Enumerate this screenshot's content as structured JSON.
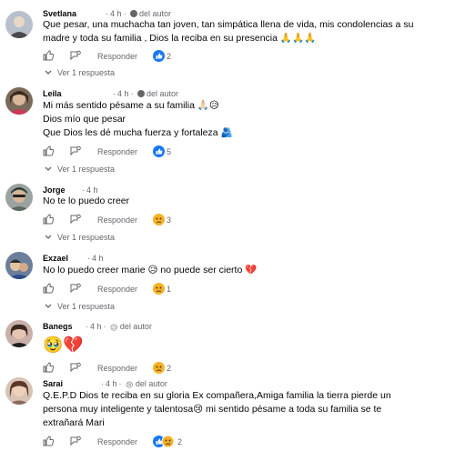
{
  "comments": [
    {
      "author": "Svetlana",
      "time": "4 h",
      "badge": "del autor",
      "lines": [
        "Que pesar, una muchacha tan joven, tan simpática llena de vida, mis condolencias a su",
        "madre y toda su familia , Dios la reciba en su presencia 🙏🙏🙏"
      ],
      "reply_label": "Responder",
      "reaction_count": "2",
      "replies_label": "Ver 1 respuesta"
    },
    {
      "author": "Leila",
      "time": "4 h",
      "badge": "del autor",
      "lines": [
        "Mi más sentido pésame a su familia 🙏🏻😥",
        "Dios mío que pesar",
        "Que Dios les dé mucha fuerza y fortaleza 🫂"
      ],
      "reply_label": "Responder",
      "reaction_count": "5",
      "replies_label": "Ver 1 respuesta"
    },
    {
      "author": "Jorge",
      "time": "4 h",
      "lines": [
        "No te lo puedo creer"
      ],
      "reply_label": "Responder",
      "reaction_count": "3",
      "replies_label": "Ver 1 respuesta"
    },
    {
      "author": "Exzael",
      "time": "4 h",
      "lines": [
        "No lo puedo creer marie 😥 no puede ser cierto 💔"
      ],
      "reply_label": "Responder",
      "reaction_count": "1",
      "replies_label": "Ver 1 respuesta"
    },
    {
      "author": "Banegs",
      "time": "4 h",
      "badge": "del autor",
      "lines": [
        "🥹💔"
      ],
      "reply_label": "Responder",
      "reaction_count": "2"
    },
    {
      "author": "Sarai",
      "time": "4 h",
      "badge": "del autor",
      "lines": [
        "Q.E.P.D Dios te reciba en su gloria Ex compañera,Amiga familia la tierra pierde un",
        "persona muy inteligente y talentosa😢 mi sentido pésame a toda su familia se te",
        "extrañará Mari"
      ],
      "reply_label": "Responder",
      "reaction_count": "2"
    }
  ],
  "colors": {
    "text": "#050505",
    "meta": "#65676b",
    "like_blue": "#1877f2",
    "care_yellow": "#f7b125"
  },
  "icons": [
    "thumbs-up-outline-icon",
    "share-action-icon",
    "like-reaction-icon",
    "care-reaction-icon",
    "author-badge-icon",
    "chevron-down-icon"
  ]
}
